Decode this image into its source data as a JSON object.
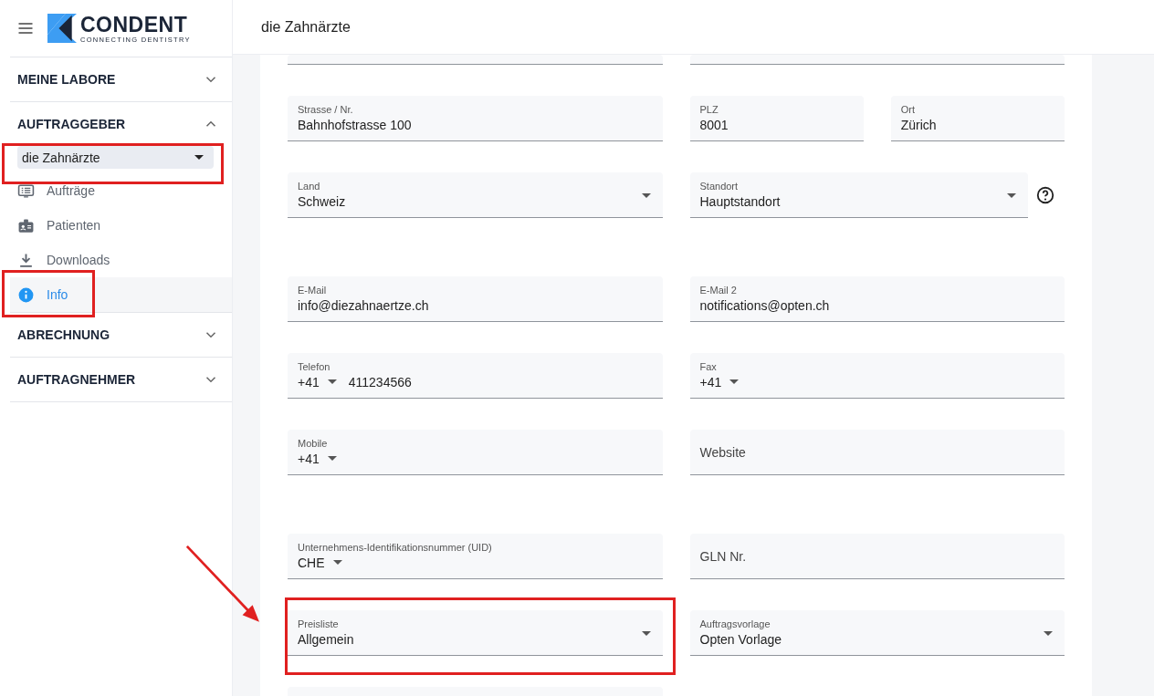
{
  "logo": {
    "name": "CONDENT",
    "tagline": "CONNECTING DENTISTRY"
  },
  "header": {
    "title": "die Zahnärzte"
  },
  "sidebar": {
    "sections": [
      {
        "title": "MEINE LABORE",
        "expanded": false
      },
      {
        "title": "AUFTRAGGEBER",
        "expanded": true,
        "selector": {
          "value": "die Zahnärzte",
          "highlighted": true
        },
        "items": [
          {
            "label": "Aufträge",
            "selected": false,
            "highlighted": false
          },
          {
            "label": "Patienten",
            "selected": false,
            "highlighted": false
          },
          {
            "label": "Downloads",
            "selected": false,
            "highlighted": false
          },
          {
            "label": "Info",
            "selected": true,
            "highlighted": true
          }
        ]
      },
      {
        "title": "ABRECHNUNG",
        "expanded": false
      },
      {
        "title": "AUFTRAGNEHMER",
        "expanded": false
      }
    ]
  },
  "form": {
    "groups": [
      {
        "rows": [
          {
            "fields": [
              {
                "kind": "blank"
              },
              {
                "kind": "blank"
              }
            ]
          },
          {
            "fields": [
              {
                "kind": "text",
                "label": "Strasse / Nr.",
                "value": "Bahnhofstrasse 100"
              },
              {
                "kind": "text",
                "label": "PLZ",
                "value": "8001"
              },
              {
                "kind": "text",
                "label": "Ort",
                "value": "Zürich"
              }
            ]
          },
          {
            "fields": [
              {
                "kind": "select",
                "label": "Land",
                "value": "Schweiz"
              },
              {
                "kind": "select",
                "label": "Standort",
                "value": "Hauptstandort",
                "help": true
              }
            ]
          }
        ]
      },
      {
        "rows": [
          {
            "fields": [
              {
                "kind": "text",
                "label": "E-Mail",
                "value": "info@diezahnaertze.ch"
              },
              {
                "kind": "text",
                "label": "E-Mail 2",
                "value": "notifications@opten.ch"
              }
            ]
          },
          {
            "fields": [
              {
                "kind": "phone",
                "label": "Telefon",
                "prefix": "+41",
                "value": "411234566"
              },
              {
                "kind": "phone",
                "label": "Fax",
                "prefix": "+41"
              }
            ]
          },
          {
            "fields": [
              {
                "kind": "phone",
                "label": "Mobile",
                "prefix": "+41"
              },
              {
                "kind": "empty",
                "label": "Website"
              }
            ]
          }
        ]
      },
      {
        "rows": [
          {
            "fields": [
              {
                "kind": "phone",
                "label": "Unternehmens-Identifikationsnummer (UID)",
                "prefix": "CHE"
              },
              {
                "kind": "empty",
                "label": "GLN Nr."
              }
            ]
          },
          {
            "fields": [
              {
                "kind": "select",
                "label": "Preisliste",
                "value": "Allgemein",
                "highlighted": true,
                "arrow": true
              },
              {
                "kind": "select",
                "label": "Auftragsvorlage",
                "value": "Opten Vorlage"
              }
            ]
          },
          {
            "fields": [
              {
                "kind": "blank"
              }
            ]
          }
        ]
      }
    ]
  }
}
